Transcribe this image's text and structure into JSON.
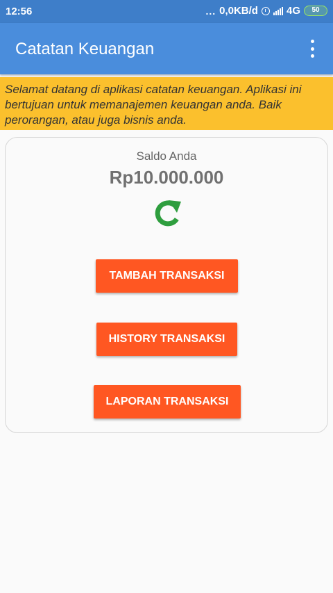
{
  "status_bar": {
    "time": "12:56",
    "dots": "...",
    "network_speed": "0,0KB/d",
    "network_type": "4G",
    "battery": "50"
  },
  "app_bar": {
    "title": "Catatan Keuangan",
    "menu_icon": "overflow-menu-icon"
  },
  "banner": {
    "text": "Selamat datang di aplikasi catatan keuangan. Aplikasi ini bertujuan untuk memanajemen keuangan anda. Baik perorangan, atau juga bisnis anda."
  },
  "balance": {
    "label": "Saldo Anda",
    "value": "Rp10.000.000",
    "refresh_icon": "refresh-icon"
  },
  "buttons": {
    "add_transaction": "TAMBAH TRANSAKSI",
    "transaction_history": "HISTORY TRANSAKSI",
    "transaction_report": "LAPORAN TRANSAKSI"
  },
  "colors": {
    "status_bar": "#3e7ec9",
    "app_bar": "#4a8ddc",
    "banner": "#fbc02d",
    "button": "#ff5722",
    "refresh": "#2e9e3e"
  }
}
